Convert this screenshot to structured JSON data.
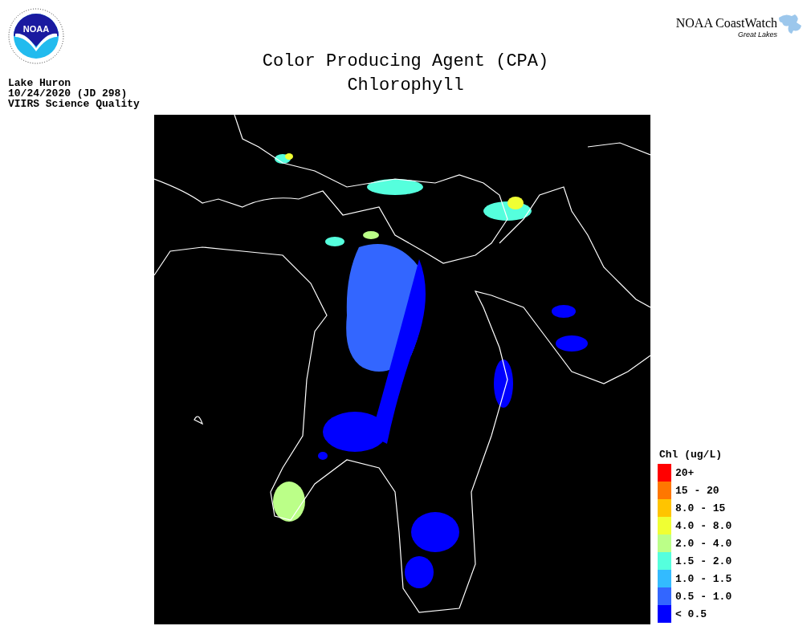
{
  "noaa_logo": {
    "text": "NOAA"
  },
  "brand_logo": {
    "title": "NOAA CoastWatch",
    "subtitle": "Great Lakes"
  },
  "title": [
    "Color Producing Agent (CPA)",
    "Chlorophyll"
  ],
  "info": [
    "Lake Huron",
    "10/24/2020 (JD 298)",
    "VIIRS Science Quality"
  ],
  "legend": {
    "title": "Chl (ug/L)",
    "items": [
      {
        "label": "20+",
        "color": "#ff0000"
      },
      {
        "label": "15 - 20",
        "color": "#ff7700"
      },
      {
        "label": "8.0 - 15",
        "color": "#ffc400"
      },
      {
        "label": "4.0 - 8.0",
        "color": "#f0ff33"
      },
      {
        "label": "2.0 - 4.0",
        "color": "#bbff88"
      },
      {
        "label": "1.5 - 2.0",
        "color": "#55ffdd"
      },
      {
        "label": "1.0 - 1.5",
        "color": "#33bbff"
      },
      {
        "label": "0.5 - 1.0",
        "color": "#3366ff"
      },
      {
        "label": "< 0.5",
        "color": "#0000ff"
      }
    ]
  }
}
